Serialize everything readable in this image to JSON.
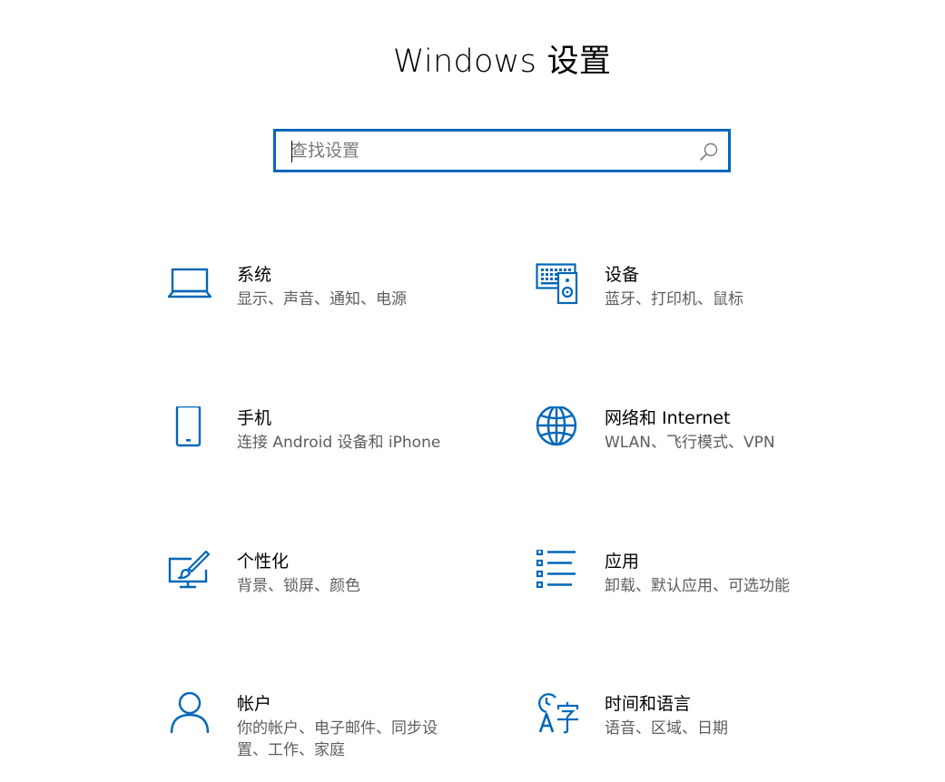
{
  "header": {
    "title": "Windows 设置"
  },
  "search": {
    "placeholder": "查找设置",
    "value": ""
  },
  "accent_color": "#0067b8",
  "categories": [
    {
      "title": "系统",
      "description": "显示、声音、通知、电源",
      "icon": "laptop-icon"
    },
    {
      "title": "设备",
      "description": "蓝牙、打印机、鼠标",
      "icon": "devices-icon"
    },
    {
      "title": "手机",
      "description": "连接 Android 设备和 iPhone",
      "icon": "phone-icon"
    },
    {
      "title": "网络和 Internet",
      "description": "WLAN、飞行模式、VPN",
      "icon": "globe-icon"
    },
    {
      "title": "个性化",
      "description": "背景、锁屏、颜色",
      "icon": "personalization-icon"
    },
    {
      "title": "应用",
      "description": "卸载、默认应用、可选功能",
      "icon": "apps-list-icon"
    },
    {
      "title": "帐户",
      "description": "你的帐户、电子邮件、同步设置、工作、家庭",
      "icon": "person-icon"
    },
    {
      "title": "时间和语言",
      "description": "语音、区域、日期",
      "icon": "time-language-icon"
    }
  ]
}
